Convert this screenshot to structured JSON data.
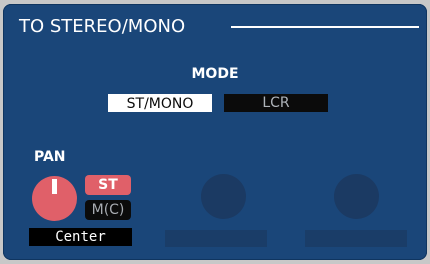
{
  "panel": {
    "title": "TO STEREO/MONO"
  },
  "mode": {
    "label": "MODE",
    "options": [
      "ST/MONO",
      "LCR"
    ],
    "selected": "ST/MONO"
  },
  "pan": {
    "label": "PAN",
    "st_label": "ST",
    "mc_label": "M(C)",
    "st_active": true,
    "mc_active": false,
    "value": "Center"
  },
  "colors": {
    "panel_bg": "#1a4679",
    "knob_active": "#e06069",
    "button_selected_bg": "#ffffff",
    "button_unselected_bg": "#0b0b0b",
    "inactive_knob": "#1b3a63",
    "inactive_display": "#1a3d68"
  }
}
